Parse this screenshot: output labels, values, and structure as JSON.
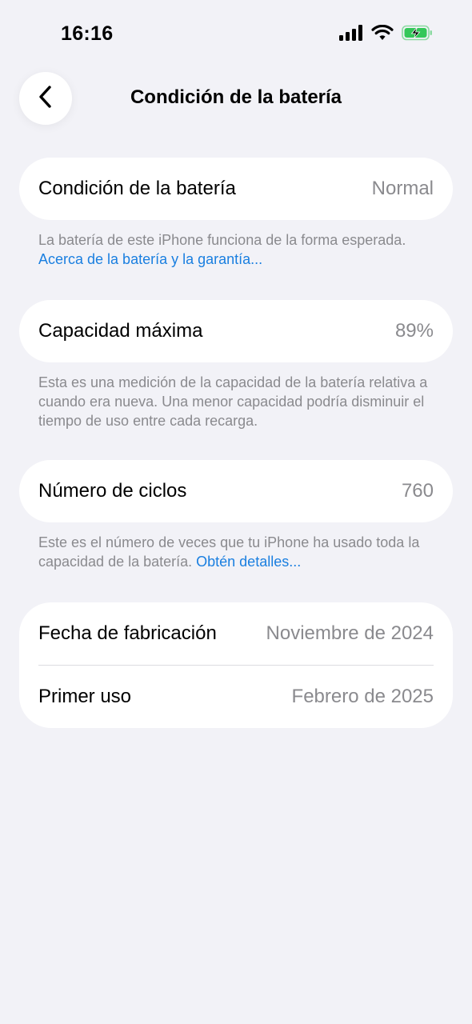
{
  "status_bar": {
    "time": "16:16",
    "icons": [
      "signal-icon",
      "wifi-icon",
      "battery-charging-icon"
    ],
    "battery_color": "#34c759"
  },
  "nav": {
    "back_icon": "chevron-left-icon",
    "title": "Condición de la batería"
  },
  "sections": {
    "health": {
      "label": "Condición de la batería",
      "value": "Normal",
      "footnote_text": "La batería de este iPhone funciona de la forma esperada. ",
      "footnote_link": "Acerca de la batería y la garantía..."
    },
    "capacity": {
      "label": "Capacidad máxima",
      "value": "89%",
      "footnote_text": "Esta es una medición de la capacidad de la batería relativa a cuando era nueva. Una menor capacidad podría disminuir el tiempo de uso entre cada recarga."
    },
    "cycles": {
      "label": "Número de ciclos",
      "value": "760",
      "footnote_text": "Este es el número de veces que tu iPhone ha usado toda la capacidad de la batería. ",
      "footnote_link": "Obtén detalles..."
    },
    "dates": {
      "manufacture_label": "Fecha de fabricación",
      "manufacture_value": "Noviembre de 2024",
      "first_use_label": "Primer uso",
      "first_use_value": "Febrero de 2025"
    }
  },
  "colors": {
    "background": "#f2f2f7",
    "link": "#1a7fe0",
    "secondary_text": "#8a8a8e"
  }
}
